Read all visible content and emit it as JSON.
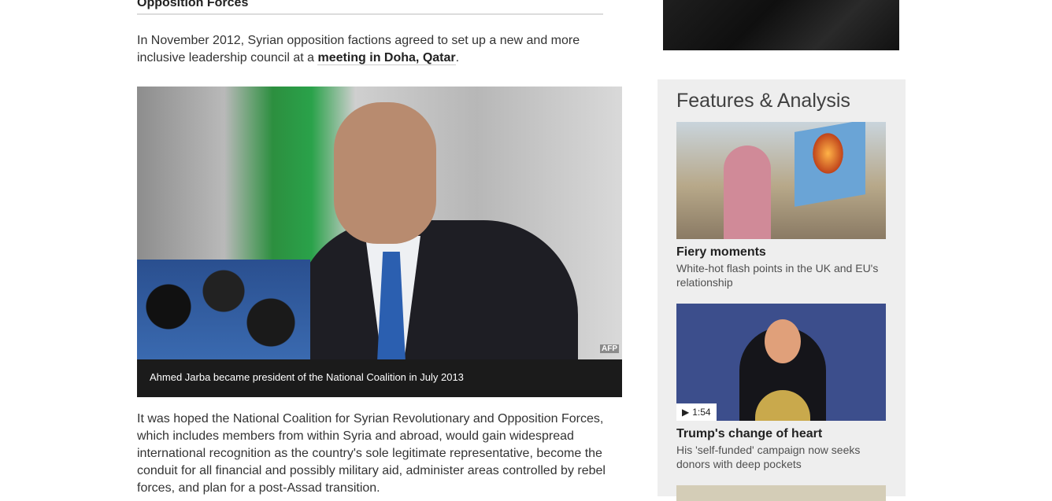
{
  "article": {
    "subhead": "Opposition Forces",
    "para1_before": "In November 2012, Syrian opposition factions agreed to set up a new and more inclusive leadership council at a ",
    "para1_link": "meeting in Doha, Qatar",
    "para1_after": ".",
    "figure": {
      "credit": "AFP",
      "caption": "Ahmed Jarba became president of the National Coalition in July 2013"
    },
    "para2": "It was hoped the National Coalition for Syrian Revolutionary and Opposition Forces, which includes members from within Syria and abroad, would gain widespread international recognition as the country's sole legitimate representative, become the conduit for all financial and possibly military aid, administer areas controlled by rebel forces, and plan for a post-Assad transition."
  },
  "sidebar": {
    "title": "Features & Analysis",
    "cards": [
      {
        "title": "Fiery moments",
        "text": "White-hot flash points in the UK and EU's relationship"
      },
      {
        "title": "Trump's change of heart",
        "text": "His 'self-funded' campaign now seeks donors with deep pockets",
        "duration": "1:54"
      }
    ]
  }
}
